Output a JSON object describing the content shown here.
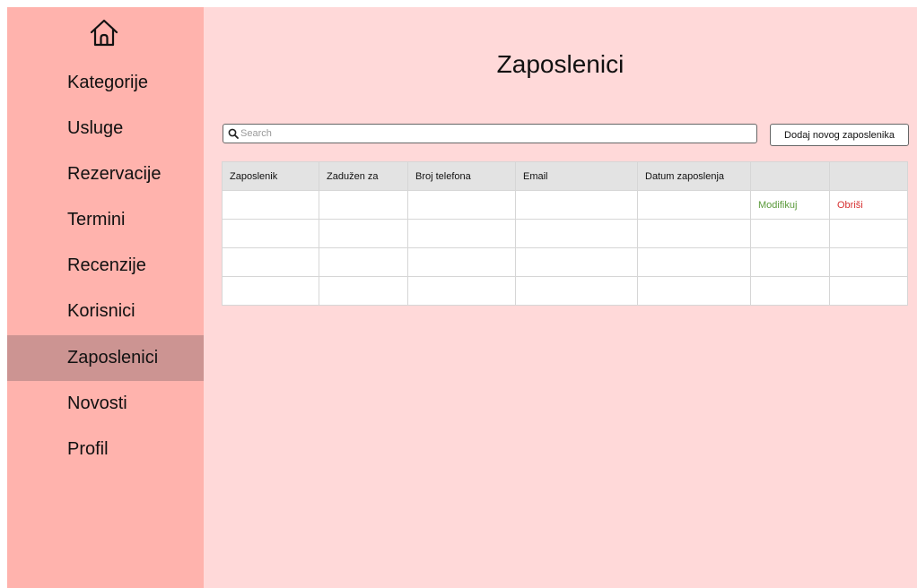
{
  "sidebar": {
    "home_icon": "home-icon",
    "items": [
      {
        "label": "Kategorije",
        "active": false
      },
      {
        "label": "Usluge",
        "active": false
      },
      {
        "label": "Rezervacije",
        "active": false
      },
      {
        "label": "Termini",
        "active": false
      },
      {
        "label": "Recenzije",
        "active": false
      },
      {
        "label": "Korisnici",
        "active": false
      },
      {
        "label": "Zaposlenici",
        "active": true
      },
      {
        "label": "Novosti",
        "active": false
      },
      {
        "label": "Profil",
        "active": false
      }
    ]
  },
  "main": {
    "title": "Zaposlenici",
    "search": {
      "placeholder": "Search",
      "value": "",
      "icon": "search-icon"
    },
    "add_button": "Dodaj novog zaposlenika",
    "table": {
      "columns": [
        "Zaposlenik",
        "Zadužen za",
        "Broj telefona",
        "Email",
        "Datum zaposlenja",
        "",
        ""
      ],
      "rows": [
        [
          "",
          "",
          "",
          "",
          "",
          "Modifikuj",
          "Obriši"
        ],
        [
          "",
          "",
          "",
          "",
          "",
          "",
          ""
        ],
        [
          "",
          "",
          "",
          "",
          "",
          "",
          ""
        ],
        [
          "",
          "",
          "",
          "",
          "",
          "",
          ""
        ]
      ]
    }
  },
  "colors": {
    "sidebar_bg": "#ffb3ad",
    "sidebar_active": "#cc9492",
    "content_bg": "#ffd9d9",
    "header_row_bg": "#e3e3e3",
    "modify_link": "#5a9a3a",
    "delete_link": "#d63030"
  }
}
